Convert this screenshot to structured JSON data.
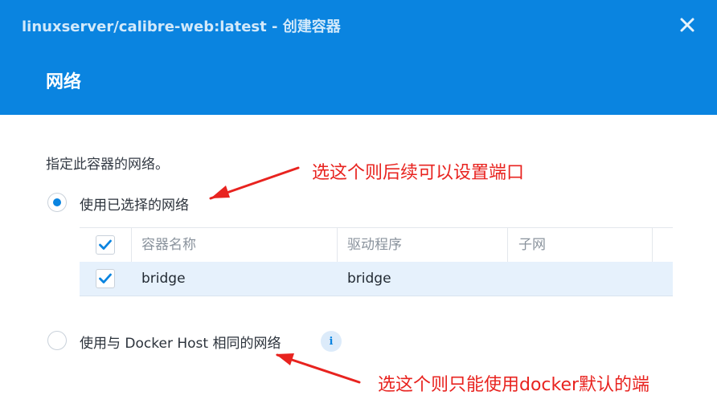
{
  "window": {
    "title": "linuxserver/calibre-web:latest - 创建容器",
    "close_icon": "close-icon"
  },
  "section": {
    "title": "网络",
    "description": "指定此容器的网络。"
  },
  "options": {
    "selected_network_label": "使用已选择的网络",
    "selected_network_checked": true,
    "host_network_label": "使用与 Docker Host 相同的网络",
    "host_network_checked": false,
    "info_icon": "info-icon"
  },
  "table": {
    "columns": [
      "容器名称",
      "驱动程序",
      "子网"
    ],
    "rows": [
      {
        "checked": true,
        "name": "bridge",
        "driver": "bridge",
        "subnet": ""
      }
    ],
    "header_checked": true
  },
  "annotations": {
    "top_note": "选这个则后续可以设置端口",
    "bottom_note": "选这个则只能使用docker默认的端"
  },
  "colors": {
    "header_bg": "#0a84e0",
    "accent": "#0a84e0",
    "annotation": "#e8231f",
    "selected_row_bg": "#e6f1fc"
  }
}
